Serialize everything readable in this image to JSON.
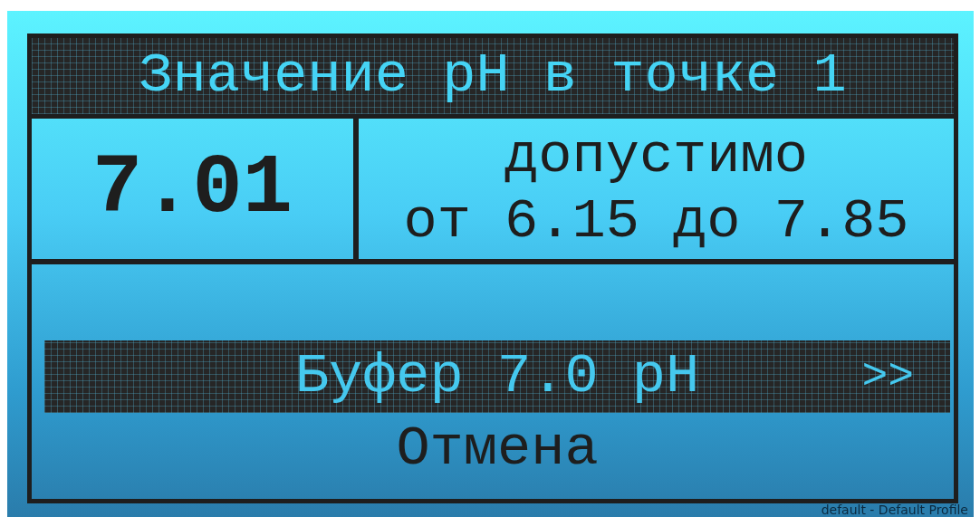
{
  "title": "Значение pH в точке 1",
  "reading": {
    "value": "7.01"
  },
  "limits": {
    "label": "допустимо",
    "range": "от 6.15 до 7.85"
  },
  "menu": [
    {
      "label": "Буфер 7.0 pH",
      "selected": true,
      "arrow": ">>"
    },
    {
      "label": "Отмена",
      "selected": false
    }
  ],
  "status_text": "default - Default Profile"
}
